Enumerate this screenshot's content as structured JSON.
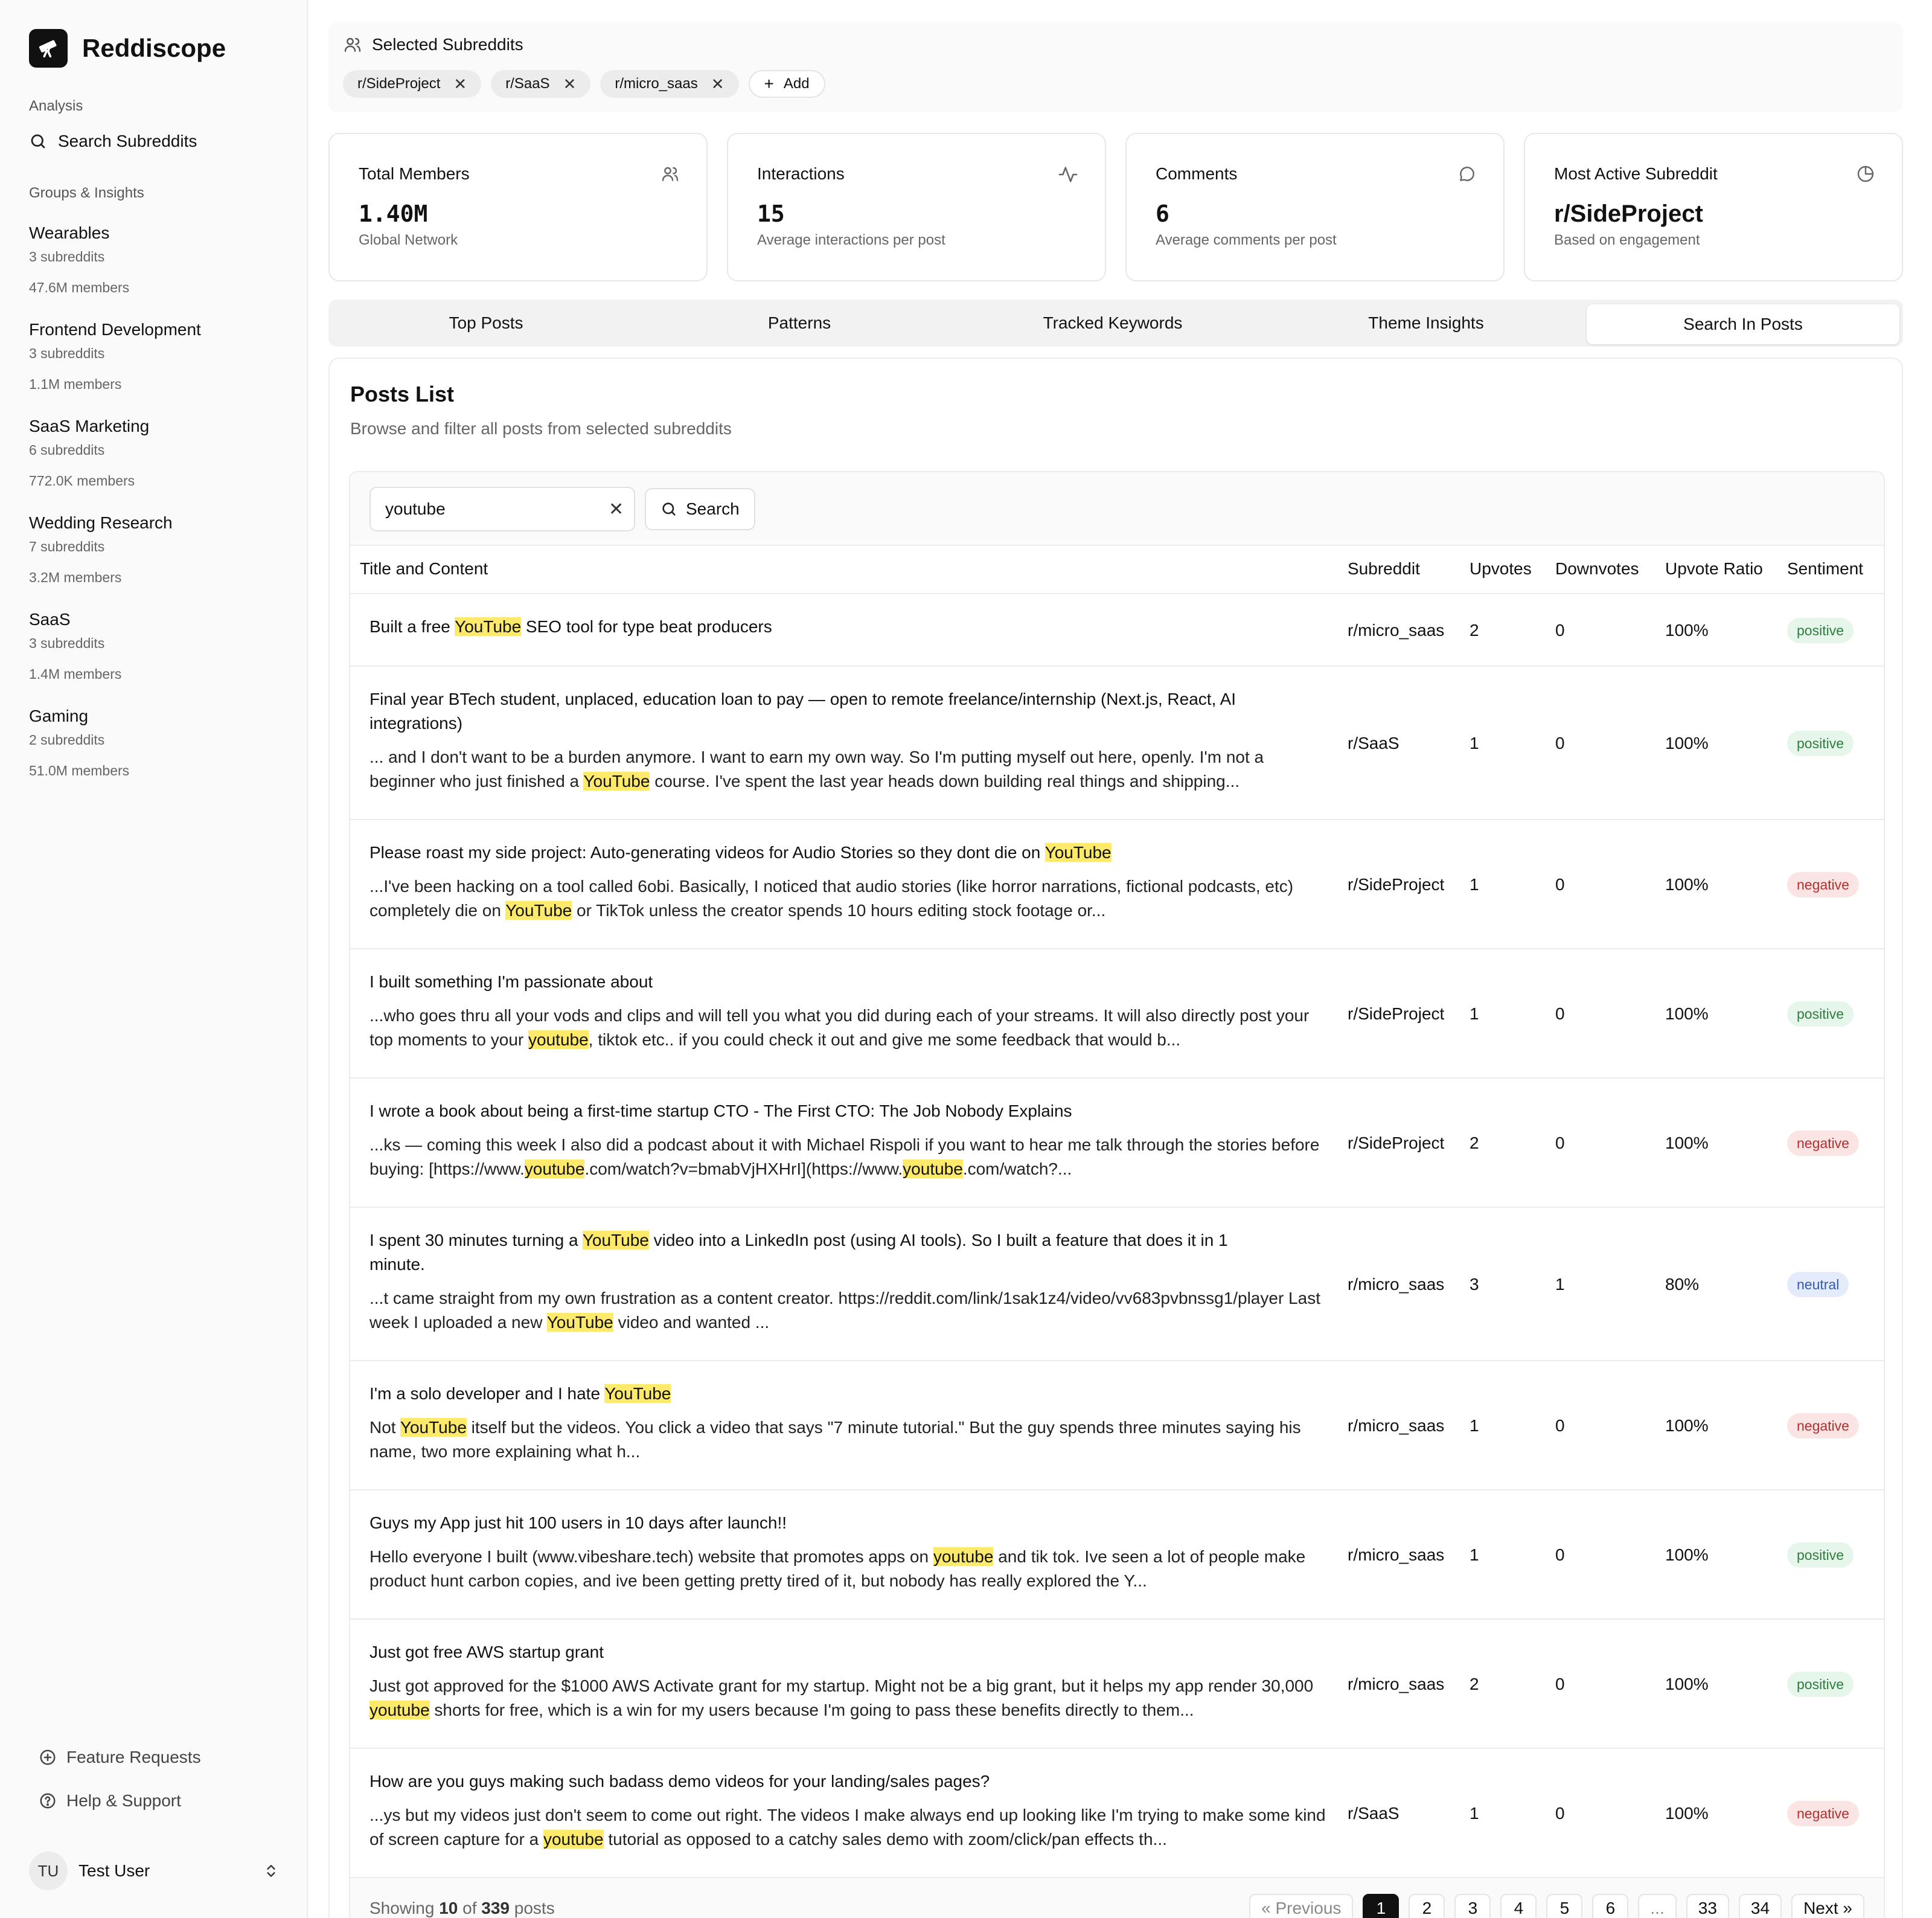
{
  "app": {
    "name": "Reddiscope"
  },
  "sidebar": {
    "analysis_label": "Analysis",
    "search_label": "Search Subreddits",
    "groups_label": "Groups & Insights",
    "groups": [
      {
        "name": "Wearables",
        "subreddits": "3 subreddits",
        "members": "47.6M members"
      },
      {
        "name": "Frontend Development",
        "subreddits": "3 subreddits",
        "members": "1.1M members"
      },
      {
        "name": "SaaS Marketing",
        "subreddits": "6 subreddits",
        "members": "772.0K members"
      },
      {
        "name": "Wedding Research",
        "subreddits": "7 subreddits",
        "members": "3.2M members"
      },
      {
        "name": "SaaS",
        "subreddits": "3 subreddits",
        "members": "1.4M members"
      },
      {
        "name": "Gaming",
        "subreddits": "2 subreddits",
        "members": "51.0M members"
      }
    ],
    "feature_requests": "Feature Requests",
    "help_support": "Help & Support",
    "user": {
      "initials": "TU",
      "name": "Test User"
    }
  },
  "selected": {
    "title": "Selected Subreddits",
    "chips": [
      "r/SideProject",
      "r/SaaS",
      "r/micro_saas"
    ],
    "add_label": "Add"
  },
  "stats": [
    {
      "label": "Total Members",
      "value": "1.40M",
      "sub": "Global Network",
      "icon": "users-icon"
    },
    {
      "label": "Interactions",
      "value": "15",
      "sub": "Average interactions per post",
      "icon": "activity-icon"
    },
    {
      "label": "Comments",
      "value": "6",
      "sub": "Average comments per post",
      "icon": "message-circle-icon"
    },
    {
      "label": "Most Active Subreddit",
      "value": "r/SideProject",
      "sub": "Based on engagement",
      "icon": "pie-chart-icon"
    }
  ],
  "tabs": [
    "Top Posts",
    "Patterns",
    "Tracked Keywords",
    "Theme Insights",
    "Search In Posts"
  ],
  "active_tab": "Search In Posts",
  "posts": {
    "title": "Posts List",
    "subtitle": "Browse and filter all posts from selected subreddits",
    "search_value": "youtube",
    "search_button": "Search",
    "columns": [
      "Title and Content",
      "Subreddit",
      "Upvotes",
      "Downvotes",
      "Upvote Ratio",
      "Sentiment"
    ],
    "rows": [
      {
        "title": [
          "Built a free ",
          "YouTube",
          " SEO tool for type beat producers"
        ],
        "body": [],
        "subreddit": "r/micro_saas",
        "upvotes": "2",
        "downvotes": "0",
        "ratio": "100%",
        "sentiment": "positive"
      },
      {
        "title": [
          "Final year BTech student, unplaced, education loan to pay — open to remote freelance/internship (Next.js, React, AI integrations)"
        ],
        "body": [
          "... and I don't want to be a burden anymore. I want to earn my own way. So I'm putting myself out here, openly. I'm not a beginner who just finished a ",
          "YouTube",
          " course. I've spent the last year heads down building real things and shipping..."
        ],
        "subreddit": "r/SaaS",
        "upvotes": "1",
        "downvotes": "0",
        "ratio": "100%",
        "sentiment": "positive"
      },
      {
        "title": [
          "Please roast my side project: Auto-generating videos for Audio Stories so they dont die on ",
          "YouTube",
          ""
        ],
        "body": [
          "...I've been hacking on a tool called 6obi. Basically, I noticed that audio stories (like horror narrations, fictional podcasts, etc) completely die on ",
          "YouTube",
          " or TikTok unless the creator spends 10 hours editing stock footage or..."
        ],
        "subreddit": "r/SideProject",
        "upvotes": "1",
        "downvotes": "0",
        "ratio": "100%",
        "sentiment": "negative"
      },
      {
        "title": [
          "I built something I'm passionate about"
        ],
        "body": [
          "...who goes thru all your vods and clips and will tell you what you did during each of your streams. It will also directly post your top moments to your ",
          "youtube",
          ", tiktok etc.. if you could check it out and give me some feedback that would b..."
        ],
        "subreddit": "r/SideProject",
        "upvotes": "1",
        "downvotes": "0",
        "ratio": "100%",
        "sentiment": "positive"
      },
      {
        "title": [
          "I wrote a book about being a first-time startup CTO - The First CTO: The Job Nobody Explains"
        ],
        "body": [
          "...ks — coming this week I also did a podcast about it with Michael Rispoli if you want to hear me talk through the stories before buying: [https://www.",
          "youtube",
          ".com/watch?v=bmabVjHXHrI](https://www.",
          "youtube",
          ".com/watch?..."
        ],
        "subreddit": "r/SideProject",
        "upvotes": "2",
        "downvotes": "0",
        "ratio": "100%",
        "sentiment": "negative"
      },
      {
        "title": [
          "I spent 30 minutes turning a ",
          "YouTube",
          " video into a LinkedIn post (using AI tools). So I built a feature that does it in 1 minute."
        ],
        "body": [
          "...t came straight from my own frustration as a content creator. https://reddit.com/link/1sak1z4/video/vv683pvbnssg1/player Last week I uploaded a new ",
          "YouTube",
          " video and wanted ..."
        ],
        "subreddit": "r/micro_saas",
        "upvotes": "3",
        "downvotes": "1",
        "ratio": "80%",
        "sentiment": "neutral"
      },
      {
        "title": [
          "I'm a solo developer and I hate ",
          "YouTube",
          ""
        ],
        "body": [
          "Not ",
          "YouTube",
          " itself but the videos. You click a video that says \"7 minute tutorial.\" But the guy spends three minutes saying his name, two more explaining what h..."
        ],
        "subreddit": "r/micro_saas",
        "upvotes": "1",
        "downvotes": "0",
        "ratio": "100%",
        "sentiment": "negative"
      },
      {
        "title": [
          "Guys my App just hit 100 users in 10 days after launch!!"
        ],
        "body": [
          "Hello everyone I built (www.vibeshare.tech) website that promotes apps on ",
          "youtube",
          " and tik tok. Ive seen a lot of people make product hunt carbon copies, and ive been getting pretty tired of it, but nobody has really explored the Y..."
        ],
        "subreddit": "r/micro_saas",
        "upvotes": "1",
        "downvotes": "0",
        "ratio": "100%",
        "sentiment": "positive"
      },
      {
        "title": [
          "Just got free AWS startup grant"
        ],
        "body": [
          "Just got approved for the $1000 AWS Activate grant for my startup. Might not be a big grant, but it helps my app render 30,000 ",
          "youtube",
          " shorts for free, which is a win for my users because I'm going to pass these benefits directly to them..."
        ],
        "subreddit": "r/micro_saas",
        "upvotes": "2",
        "downvotes": "0",
        "ratio": "100%",
        "sentiment": "positive"
      },
      {
        "title": [
          "How are you guys making such badass demo videos for your landing/sales pages?"
        ],
        "body": [
          "...ys but my videos just don't seem to come out right. The videos I make always end up looking like I'm trying to make some kind of screen capture for a ",
          "youtube",
          " tutorial as opposed to a catchy sales demo with zoom/click/pan effects th..."
        ],
        "subreddit": "r/SaaS",
        "upvotes": "1",
        "downvotes": "0",
        "ratio": "100%",
        "sentiment": "negative"
      }
    ],
    "footer": {
      "showing_prefix": "Showing ",
      "shown": "10",
      "of_text": " of ",
      "total": "339",
      "suffix": " posts"
    },
    "pagination": {
      "previous": "« Previous",
      "pages": [
        "1",
        "2",
        "3",
        "4",
        "5",
        "6",
        "...",
        "33",
        "34"
      ],
      "current": "1",
      "next": "Next »"
    }
  }
}
